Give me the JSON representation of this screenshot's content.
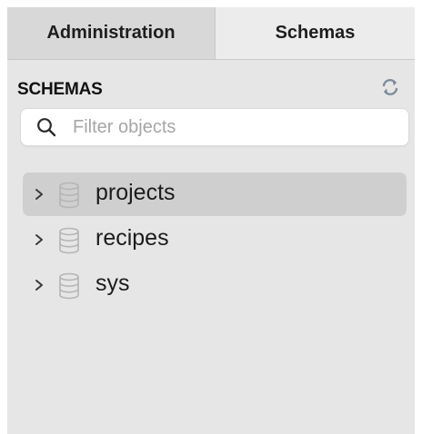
{
  "tabs": [
    {
      "label": "Administration",
      "active": false
    },
    {
      "label": "Schemas",
      "active": true
    }
  ],
  "panel": {
    "title": "SCHEMAS",
    "refresh_icon": "refresh-icon"
  },
  "search": {
    "placeholder": "Filter objects",
    "value": "",
    "icon": "search-icon"
  },
  "schemas": [
    {
      "name": "projects",
      "selected": true,
      "icon": "database-icon"
    },
    {
      "name": "recipes",
      "selected": false,
      "icon": "database-icon"
    },
    {
      "name": "sys",
      "selected": false,
      "icon": "database-icon"
    }
  ],
  "colors": {
    "panel_bg": "#e6e6e6",
    "selected_row": "#cfcfcf",
    "inactive_tab": "#d8d8d8",
    "active_tab": "#ececec",
    "icon_gray": "#b5b5b5"
  }
}
